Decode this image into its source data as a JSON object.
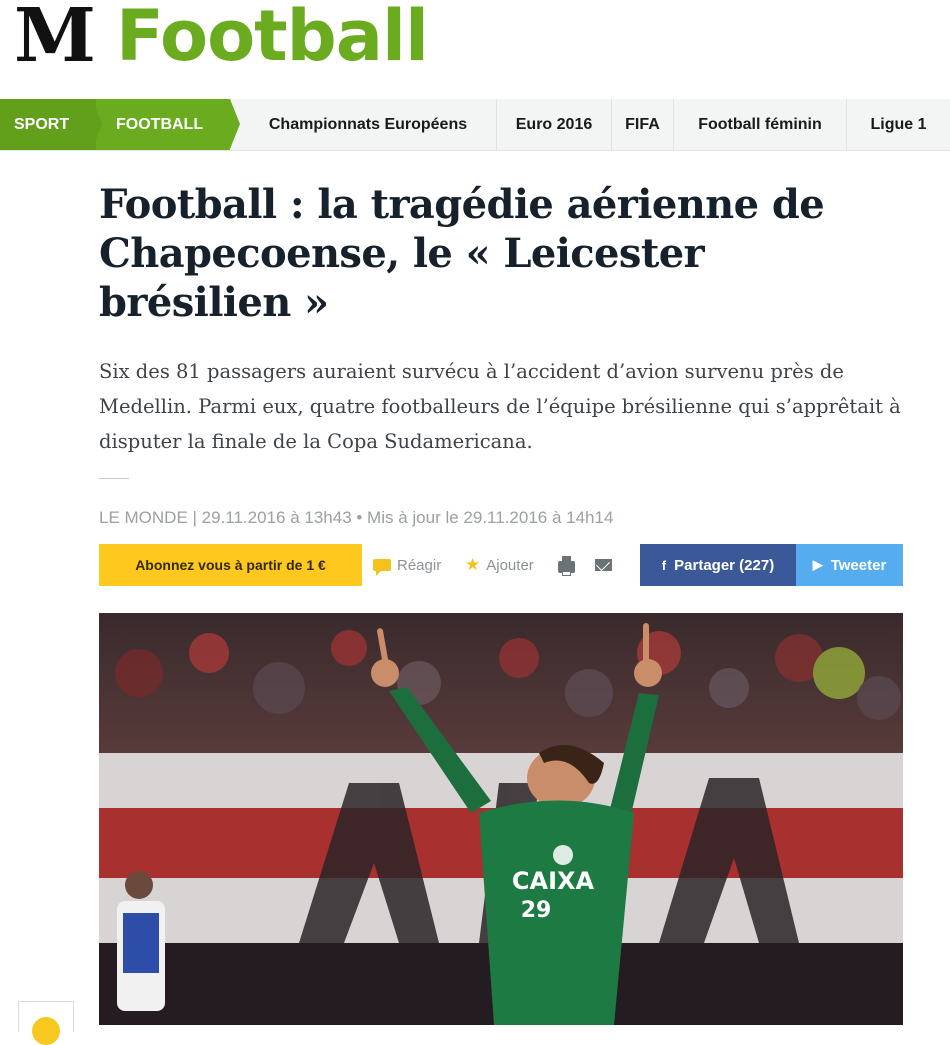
{
  "masthead": {
    "logo_letter": "M",
    "section_title": "Football",
    "accent_color": "#6aab1f"
  },
  "nav": {
    "breadcrumb": [
      "SPORT",
      "FOOTBALL"
    ],
    "items": [
      "Championnats Européens",
      "Euro 2016",
      "FIFA",
      "Football féminin",
      "Ligue 1"
    ]
  },
  "article": {
    "title": "Football : la tragédie aérienne de Chapecoense, le « Leicester brésilien »",
    "chapo": "Six des 81 passagers auraient survécu à l’accident d’avion survenu près de Medellin. Parmi eux, quatre footballeurs de l’équipe brésilienne qui s’apprêtait à disputer la finale de la Copa Sudamericana.",
    "meta": "LE MONDE | 29.11.2016 à 13h43 • Mis à jour le 29.11.2016 à 14h14"
  },
  "tools": {
    "subscribe": "Abonnez vous à partir de 1 €",
    "react": "Réagir",
    "add": "Ajouter",
    "print_icon": "printer-icon",
    "mail_icon": "envelope-icon",
    "share": "Partager (227)",
    "tweet": "Tweeter",
    "subscribe_color": "#ffc81e",
    "facebook_color": "#3b5998",
    "twitter_color": "#55acee"
  },
  "photo": {
    "jersey_sponsor": "CAIXA",
    "jersey_number": "29"
  },
  "icons": {
    "comment": "comment-bubble-icon",
    "star": "star-icon",
    "facebook": "facebook-icon",
    "twitter": "twitter-bird-icon"
  }
}
